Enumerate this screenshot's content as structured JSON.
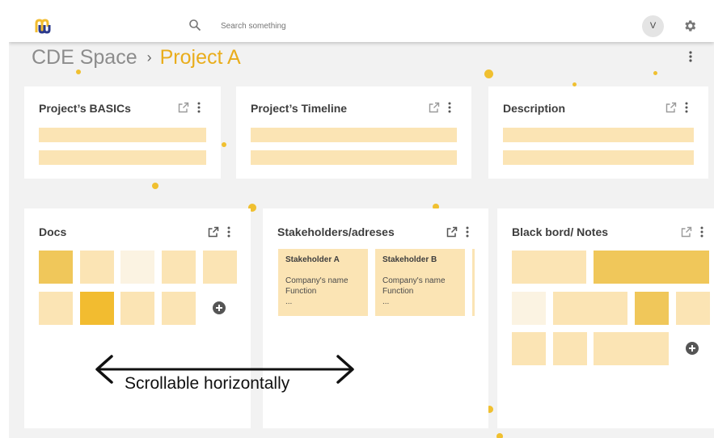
{
  "app": {
    "logo_text": "m"
  },
  "search": {
    "placeholder": "Search something"
  },
  "user": {
    "avatar_initial": "V"
  },
  "breadcrumb": {
    "root": "CDE Space",
    "separator": "›",
    "current": "Project A"
  },
  "cards": {
    "basics": {
      "title": "Project’s BASICs"
    },
    "timeline": {
      "title": "Project’s Timeline"
    },
    "description": {
      "title": "Description"
    },
    "docs": {
      "title": "Docs"
    },
    "stakeholders": {
      "title": "Stakeholders/adreses",
      "items": [
        {
          "name": "Stakeholder A",
          "company": "Company's name",
          "function": "Function",
          "more": "..."
        },
        {
          "name": "Stakeholder B",
          "company": "Company's name",
          "function": "Function",
          "more": "..."
        }
      ]
    },
    "notes": {
      "title": "Black bord/ Notes"
    }
  },
  "annotation": {
    "scroll_label": "Scrollable horizontally"
  },
  "colors": {
    "accent": "#e9ad1c",
    "tile_light": "#fbe4b4",
    "tile_mid": "#f0c75a",
    "tile_dark": "#f2bc30",
    "tile_pale": "#fbf3e2"
  }
}
